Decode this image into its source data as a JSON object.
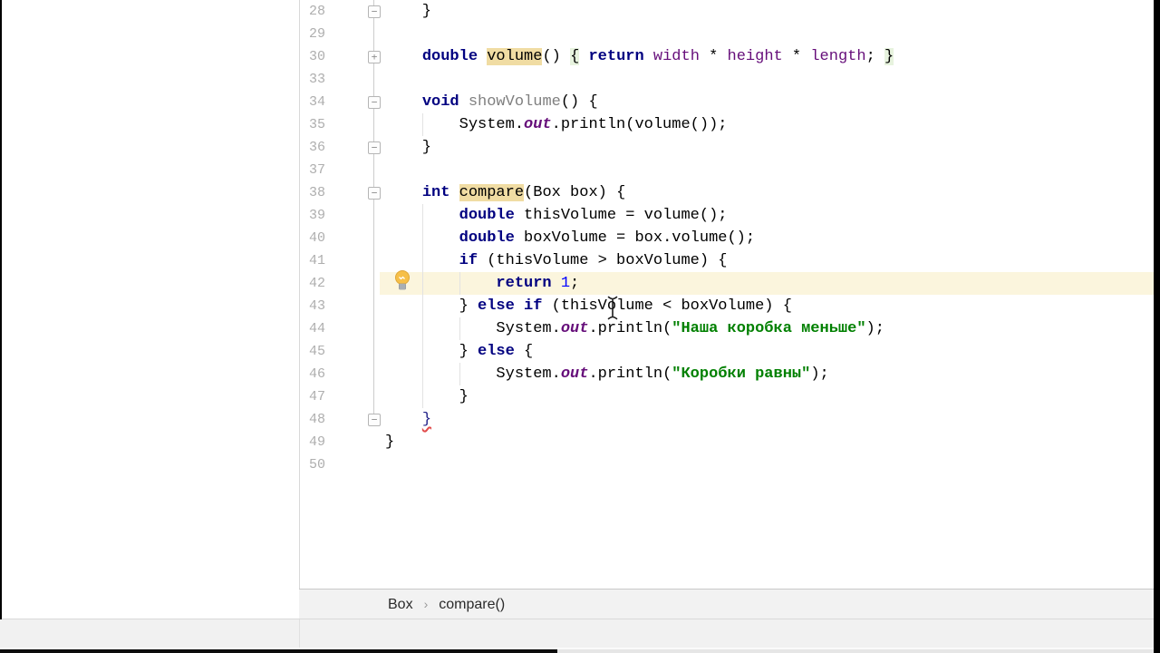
{
  "editor": {
    "caret_line": "42",
    "lines": [
      {
        "num": "28",
        "fold": "minus",
        "segments": [
          {
            "s": "plain",
            "t": "    }"
          }
        ]
      },
      {
        "num": "29",
        "segments": []
      },
      {
        "num": "30",
        "fold": "plus",
        "segments": [
          {
            "s": "plain",
            "t": "    "
          },
          {
            "s": "kw",
            "t": "double"
          },
          {
            "s": "plain",
            "t": " "
          },
          {
            "s": "plain",
            "t": "volume",
            "hl": "tan"
          },
          {
            "s": "plain",
            "t": "() "
          },
          {
            "s": "plain",
            "t": "{",
            "hl": "green"
          },
          {
            "s": "plain",
            "t": " "
          },
          {
            "s": "kw",
            "t": "return"
          },
          {
            "s": "plain",
            "t": " "
          },
          {
            "s": "fld",
            "t": "width"
          },
          {
            "s": "plain",
            "t": " * "
          },
          {
            "s": "fld",
            "t": "height"
          },
          {
            "s": "plain",
            "t": " * "
          },
          {
            "s": "fld",
            "t": "length"
          },
          {
            "s": "plain",
            "t": "; "
          },
          {
            "s": "plain",
            "t": "}",
            "hl": "green"
          }
        ]
      },
      {
        "num": "33",
        "segments": []
      },
      {
        "num": "34",
        "fold": "minus",
        "segments": [
          {
            "s": "plain",
            "t": "    "
          },
          {
            "s": "kw",
            "t": "void"
          },
          {
            "s": "plain",
            "t": " "
          },
          {
            "s": "gray",
            "t": "showVolume"
          },
          {
            "s": "plain",
            "t": "() {"
          }
        ]
      },
      {
        "num": "35",
        "guides": [
          4
        ],
        "segments": [
          {
            "s": "plain",
            "t": "        System."
          },
          {
            "s": "out",
            "t": "out"
          },
          {
            "s": "plain",
            "t": ".println(volume());"
          }
        ]
      },
      {
        "num": "36",
        "fold": "minus",
        "segments": [
          {
            "s": "plain",
            "t": "    }"
          }
        ]
      },
      {
        "num": "37",
        "segments": []
      },
      {
        "num": "38",
        "fold": "minus",
        "segments": [
          {
            "s": "plain",
            "t": "    "
          },
          {
            "s": "kw",
            "t": "int"
          },
          {
            "s": "plain",
            "t": " "
          },
          {
            "s": "plain",
            "t": "compare",
            "hl": "tan"
          },
          {
            "s": "plain",
            "t": "(Box box) {"
          }
        ]
      },
      {
        "num": "39",
        "guides": [
          4
        ],
        "segments": [
          {
            "s": "plain",
            "t": "        "
          },
          {
            "s": "kw",
            "t": "double"
          },
          {
            "s": "plain",
            "t": " thisVolume = volume();"
          }
        ]
      },
      {
        "num": "40",
        "guides": [
          4
        ],
        "segments": [
          {
            "s": "plain",
            "t": "        "
          },
          {
            "s": "kw",
            "t": "double"
          },
          {
            "s": "plain",
            "t": " boxVolume = box.volume();"
          }
        ]
      },
      {
        "num": "41",
        "guides": [
          4
        ],
        "segments": [
          {
            "s": "plain",
            "t": "        "
          },
          {
            "s": "kw",
            "t": "if"
          },
          {
            "s": "plain",
            "t": " (thisVolume > boxVolume) {"
          }
        ]
      },
      {
        "num": "42",
        "caret": true,
        "bulb": true,
        "guides": [
          4,
          8
        ],
        "segments": [
          {
            "s": "plain",
            "t": "            "
          },
          {
            "s": "kw",
            "t": "return"
          },
          {
            "s": "plain",
            "t": " "
          },
          {
            "s": "num",
            "t": "1"
          },
          {
            "s": "plain",
            "t": ";"
          }
        ]
      },
      {
        "num": "43",
        "guides": [
          4
        ],
        "segments": [
          {
            "s": "plain",
            "t": "        } "
          },
          {
            "s": "kw",
            "t": "else"
          },
          {
            "s": "plain",
            "t": " "
          },
          {
            "s": "kw",
            "t": "if"
          },
          {
            "s": "plain",
            "t": " (thisVolume < boxVolume) {"
          }
        ]
      },
      {
        "num": "44",
        "guides": [
          4,
          8
        ],
        "segments": [
          {
            "s": "plain",
            "t": "            System."
          },
          {
            "s": "out",
            "t": "out"
          },
          {
            "s": "plain",
            "t": ".println("
          },
          {
            "s": "str",
            "t": "\"Наша коробка меньше\""
          },
          {
            "s": "plain",
            "t": ");"
          }
        ]
      },
      {
        "num": "45",
        "guides": [
          4
        ],
        "segments": [
          {
            "s": "plain",
            "t": "        } "
          },
          {
            "s": "kw",
            "t": "else"
          },
          {
            "s": "plain",
            "t": " {"
          }
        ]
      },
      {
        "num": "46",
        "guides": [
          4,
          8
        ],
        "segments": [
          {
            "s": "plain",
            "t": "            System."
          },
          {
            "s": "out",
            "t": "out"
          },
          {
            "s": "plain",
            "t": ".println("
          },
          {
            "s": "str",
            "t": "\"Коробки равны\""
          },
          {
            "s": "plain",
            "t": ");"
          }
        ]
      },
      {
        "num": "47",
        "guides": [
          4
        ],
        "segments": [
          {
            "s": "plain",
            "t": "        }"
          }
        ]
      },
      {
        "num": "48",
        "fold": "minus",
        "segments": [
          {
            "s": "plain",
            "t": "    "
          },
          {
            "s": "err",
            "t": "}"
          }
        ]
      },
      {
        "num": "49",
        "segments": [
          {
            "s": "plain",
            "t": "}"
          }
        ]
      },
      {
        "num": "50",
        "segments": []
      }
    ],
    "fold_glyphs": {
      "minus": "−",
      "plus": "+"
    },
    "breadcrumbs": {
      "separator": "›",
      "items": [
        {
          "label": "Box"
        },
        {
          "label": "compare()"
        }
      ]
    }
  },
  "colors": {
    "keyword": "#000080",
    "field": "#660E7A",
    "string": "#008000",
    "number": "#0000FF",
    "unused_method": "#808080",
    "caret_row_bg": "#FBF5DD",
    "usage_highlight_bg": "#F0DCA3",
    "brace_highlight_bg": "#E7F3DE",
    "gutter_number": "#AEAEAE",
    "breadcrumb_bg": "#F2F2F2"
  },
  "icons": {
    "bulb": "intention-lightbulb",
    "fold_collapsed": "fold-plus",
    "fold_expanded": "fold-minus",
    "mouse": "text-ibeam-cursor"
  }
}
